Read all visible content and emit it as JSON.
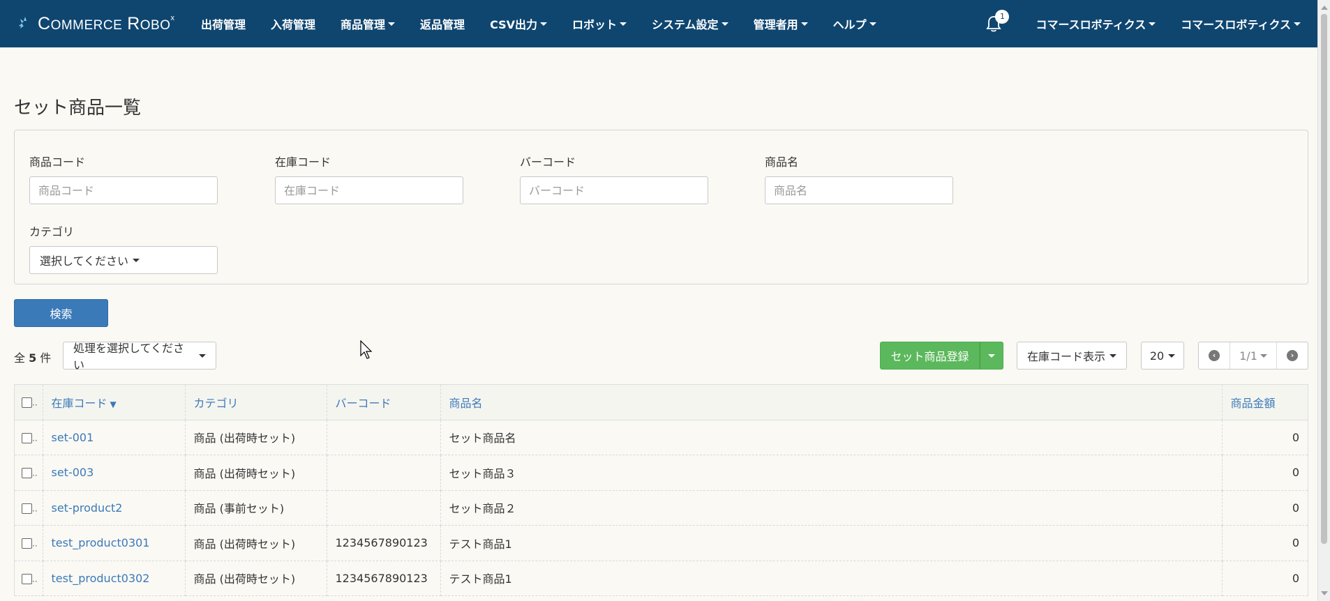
{
  "nav": {
    "brand": "Commerce Robo",
    "items": [
      {
        "label": "出荷管理",
        "dropdown": false
      },
      {
        "label": "入荷管理",
        "dropdown": false
      },
      {
        "label": "商品管理",
        "dropdown": true
      },
      {
        "label": "返品管理",
        "dropdown": false
      },
      {
        "label": "CSV出力",
        "dropdown": true
      },
      {
        "label": "ロボット",
        "dropdown": true
      },
      {
        "label": "システム設定",
        "dropdown": true
      },
      {
        "label": "管理者用",
        "dropdown": true
      },
      {
        "label": "ヘルプ",
        "dropdown": true
      }
    ],
    "notification_count": "1",
    "account1": "コマースロボティクス",
    "account2": "コマースロボティクス"
  },
  "page": {
    "title": "セット商品一覧"
  },
  "search": {
    "product_code_label": "商品コード",
    "product_code_placeholder": "商品コード",
    "stock_code_label": "在庫コード",
    "stock_code_placeholder": "在庫コード",
    "barcode_label": "バーコード",
    "barcode_placeholder": "バーコード",
    "product_name_label": "商品名",
    "product_name_placeholder": "商品名",
    "category_label": "カテゴリ",
    "category_value": "選択してください",
    "search_button": "検索"
  },
  "toolbar": {
    "total_prefix": "全",
    "total_count": "5",
    "total_suffix": "件",
    "action_select": "処理を選択してください",
    "register_button": "セット商品登録",
    "stock_code_display": "在庫コード表示",
    "per_page": "20",
    "page_indicator": "1/1"
  },
  "table": {
    "columns": {
      "stock_code": "在庫コード",
      "category": "カテゴリ",
      "barcode": "バーコード",
      "product_name": "商品名",
      "price": "商品金額"
    },
    "sort_indicator": "▼",
    "rows": [
      {
        "stock_code": "set-001",
        "category": "商品 (出荷時セット)",
        "barcode": "",
        "product_name": "セット商品名",
        "price": "0"
      },
      {
        "stock_code": "set-003",
        "category": "商品 (出荷時セット)",
        "barcode": "",
        "product_name": "セット商品３",
        "price": "0"
      },
      {
        "stock_code": "set-product2",
        "category": "商品 (事前セット)",
        "barcode": "",
        "product_name": "セット商品２",
        "price": "0"
      },
      {
        "stock_code": "test_product0301",
        "category": "商品 (出荷時セット)",
        "barcode": "1234567890123",
        "product_name": "テスト商品1",
        "price": "0"
      },
      {
        "stock_code": "test_product0302",
        "category": "商品 (出荷時セット)",
        "barcode": "1234567890123",
        "product_name": "テスト商品1",
        "price": "0"
      }
    ]
  },
  "colors": {
    "navbar": "#0f4670",
    "primary": "#3b7ab8",
    "success": "#5cb85c"
  }
}
